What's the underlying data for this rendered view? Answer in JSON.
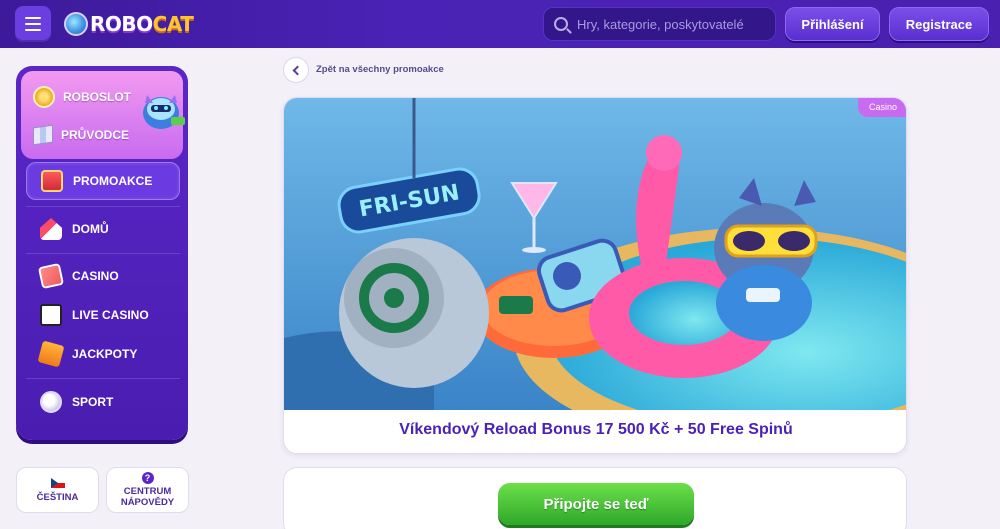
{
  "header": {
    "logo_text_robo": "ROBO",
    "logo_text_cat": "CAT",
    "search_placeholder": "Hry, kategorie, poskytovatelé",
    "login_label": "Přihlášení",
    "register_label": "Registrace"
  },
  "sidebar": {
    "promo_items": [
      {
        "label": "ROBOSLOT",
        "icon": "coin-icon"
      },
      {
        "label": "PRŮVODCE",
        "icon": "map-icon"
      }
    ],
    "items": [
      {
        "label": "PROMOAKCE",
        "icon": "gift-icon",
        "active": true
      },
      {
        "label": "DOMŮ",
        "icon": "home-icon"
      },
      {
        "label": "CASINO",
        "icon": "casino-icon"
      },
      {
        "label": "LIVE CASINO",
        "icon": "live-casino-icon"
      },
      {
        "label": "JACKPOTY",
        "icon": "jackpot-icon"
      },
      {
        "label": "SPORT",
        "icon": "sport-icon"
      }
    ],
    "language_label": "ČEŠTINA",
    "help_label_line1": "CENTRUM",
    "help_label_line2": "NÁPOVĚDY",
    "help_icon_text": "?"
  },
  "main": {
    "back_label": "Zpět na všechny promoakce",
    "badge": "Casino",
    "banner_sign": "FRI-SUN",
    "promo_title": "Víkendový Reload Bonus 17 500 Kč + 50 Free Spinů",
    "cta_label": "Připojte se teď"
  },
  "colors": {
    "brand_purple": "#4a22b5",
    "accent_pink": "#c86bf0",
    "cta_green": "#3cb832"
  }
}
